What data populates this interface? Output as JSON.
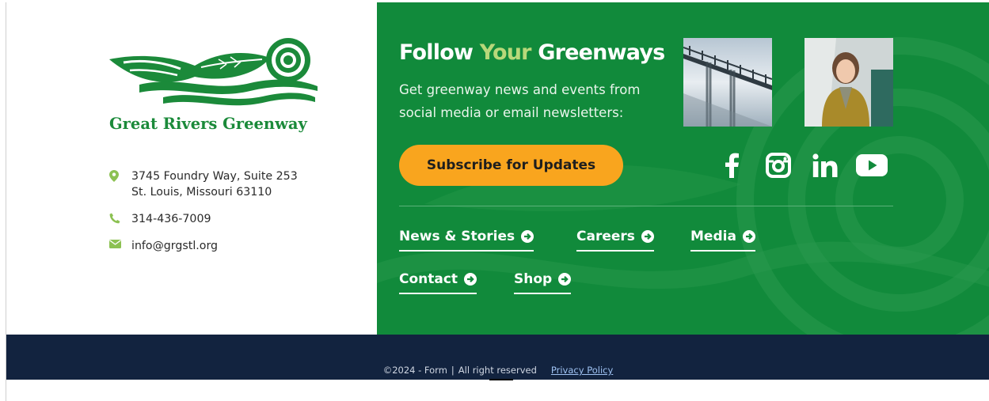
{
  "brand": {
    "name": "Great Rivers Greenway",
    "logo_icon": "leaf-river-logo-icon",
    "green": "#118a3b",
    "light_green": "#b8d87a",
    "orange": "#f9a51e",
    "navy": "#12233f"
  },
  "contact": {
    "address_line1": "3745 Foundry Way, Suite 253",
    "address_line2": "St. Louis, Missouri 63110",
    "phone": "314-436-7009",
    "email": "info@grgstl.org"
  },
  "follow": {
    "title_pre": "Follow ",
    "title_accent": "Your",
    "title_post": " Greenways",
    "description": "Get greenway news and events from social media or email newsletters:",
    "subscribe_label": "Subscribe for Updates"
  },
  "photos": [
    {
      "name": "bridge-photo"
    },
    {
      "name": "person-photo"
    }
  ],
  "socials": [
    {
      "name": "facebook-icon"
    },
    {
      "name": "instagram-icon"
    },
    {
      "name": "linkedin-icon"
    },
    {
      "name": "youtube-icon"
    }
  ],
  "nav": {
    "news": "News & Stories",
    "careers": "Careers",
    "media": "Media",
    "contact": "Contact",
    "shop": "Shop"
  },
  "footer": {
    "copyright": "©2024 - Form",
    "separator": "|",
    "rights": "All right reserved",
    "privacy": "Privacy Policy"
  }
}
